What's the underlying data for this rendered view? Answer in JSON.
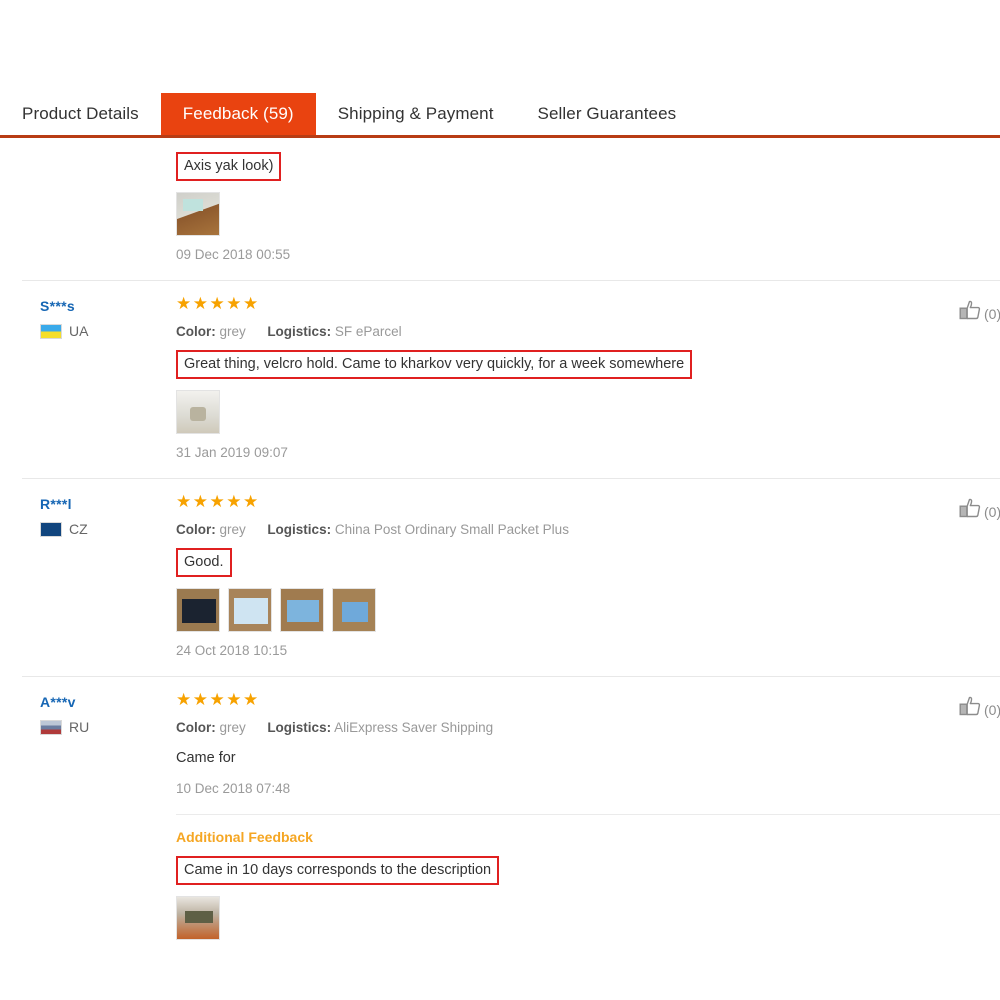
{
  "tabs": [
    {
      "label": "Product Details",
      "active": false
    },
    {
      "label": "Feedback (59)",
      "active": true
    },
    {
      "label": "Shipping & Payment",
      "active": false
    },
    {
      "label": "Seller Guarantees",
      "active": false
    }
  ],
  "labels": {
    "color": "Color:",
    "logistics": "Logistics:",
    "additional_feedback": "Additional Feedback"
  },
  "colors": {
    "accent": "#e94310",
    "tab_underline": "#b83c14",
    "star": "#f7a200",
    "user_link": "#1666b4",
    "highlight_box": "#e02020",
    "additional_title": "#f5a623"
  },
  "reviews": [
    {
      "id": "review-partial-top",
      "partial": true,
      "comment": "Axis yak look)",
      "comment_highlighted": true,
      "images": [
        {
          "alt": "feedback-photo-1"
        }
      ],
      "date": "09 Dec 2018 00:55"
    },
    {
      "id": "review-s",
      "partial": false,
      "user": "S***s",
      "country_code": "UA",
      "flag": "flag-ua-icon",
      "stars": 5,
      "color": "grey",
      "logistics": "SF eParcel",
      "comment": "Great thing, velcro hold. Came to kharkov very quickly, for a week somewhere",
      "comment_highlighted": true,
      "images": [
        {
          "alt": "feedback-photo-1"
        }
      ],
      "date": "31 Jan 2019 09:07",
      "like_count": "(0)"
    },
    {
      "id": "review-r",
      "partial": false,
      "user": "R***l",
      "country_code": "CZ",
      "flag": "flag-cz-icon",
      "stars": 5,
      "color": "grey",
      "logistics": "China Post Ordinary Small Packet Plus",
      "comment": "Good.",
      "comment_highlighted": true,
      "images": [
        {
          "alt": "feedback-photo-1"
        },
        {
          "alt": "feedback-photo-2"
        },
        {
          "alt": "feedback-photo-3"
        },
        {
          "alt": "feedback-photo-4"
        }
      ],
      "date": "24 Oct 2018 10:15",
      "like_count": "(0)"
    },
    {
      "id": "review-a",
      "partial": false,
      "user": "A***v",
      "country_code": "RU",
      "flag": "flag-ru-icon",
      "stars": 5,
      "color": "grey",
      "logistics": "AliExpress Saver Shipping",
      "comment": "Came for",
      "comment_highlighted": false,
      "images": [],
      "date": "10 Dec 2018 07:48",
      "like_count": "(0)",
      "additional": {
        "title": "Additional Feedback",
        "comment": "Came in 10 days corresponds to the description",
        "comment_highlighted": true,
        "images": [
          {
            "alt": "feedback-photo-1"
          }
        ]
      }
    }
  ]
}
